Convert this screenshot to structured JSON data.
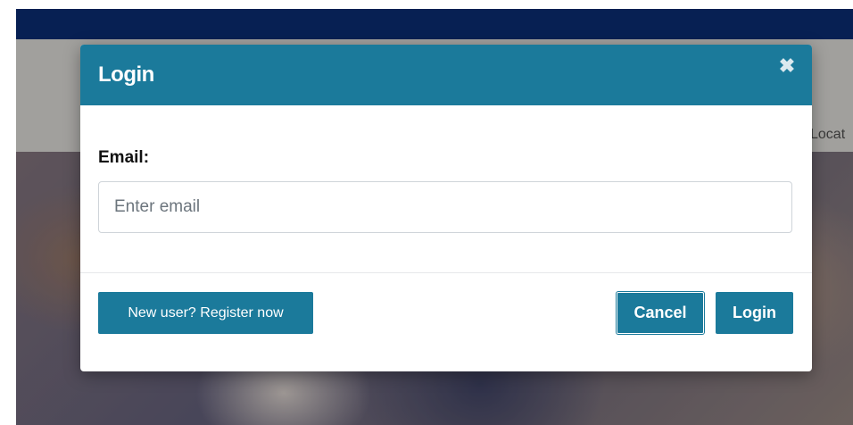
{
  "nav": {
    "partial_link": "Locat"
  },
  "modal": {
    "title": "Login",
    "close_icon": "close-icon",
    "close_glyph": "✖",
    "email_label": "Email:",
    "email_value": "",
    "email_placeholder": "Enter email",
    "register_label": "New user? Register now",
    "cancel_label": "Cancel",
    "login_label": "Login"
  },
  "colors": {
    "top_bar": "#0a2a6b",
    "modal_header": "#1b7a9b",
    "button": "#1b7a9b"
  }
}
